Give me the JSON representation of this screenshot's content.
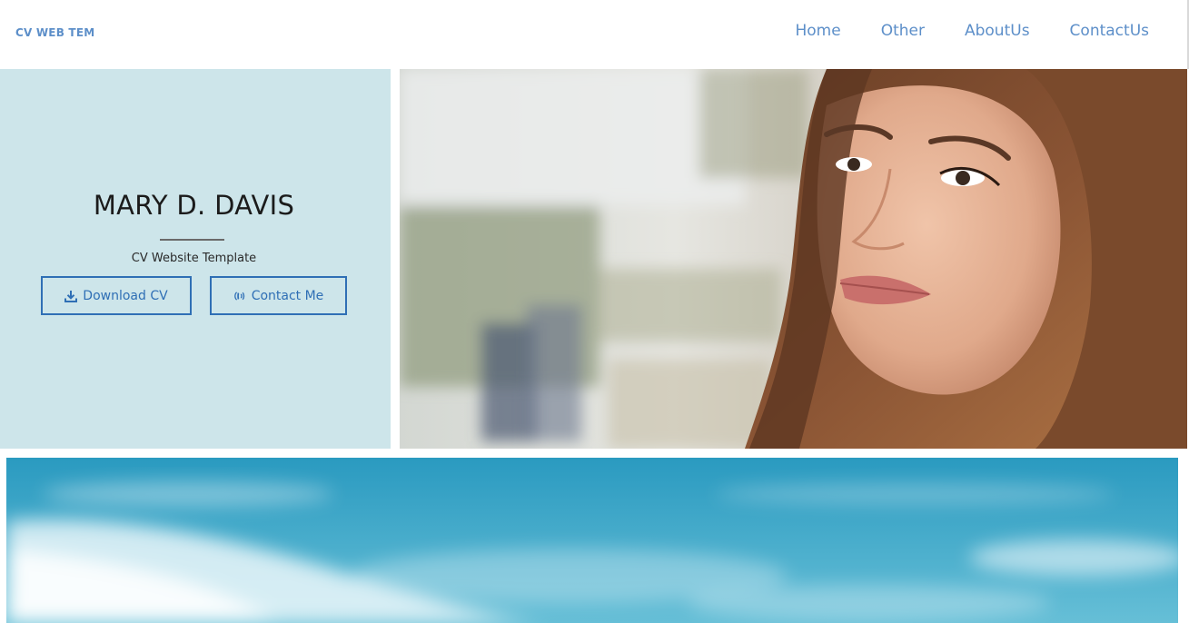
{
  "header": {
    "brand": "CV WEB TEM",
    "nav": [
      {
        "label": "Home"
      },
      {
        "label": "Other"
      },
      {
        "label": "AboutUs"
      },
      {
        "label": "ContactUs"
      }
    ]
  },
  "intro": {
    "name": "MARY D. DAVIS",
    "subtitle": "CV Website Template",
    "download_label": "Download CV",
    "download_icon": "download-icon",
    "contact_label": "Contact Me",
    "contact_icon": "phone-volume-icon"
  },
  "colors": {
    "accent": "#2f6fb5",
    "nav_text": "#5d8fc9",
    "intro_bg": "#cde5ea"
  }
}
